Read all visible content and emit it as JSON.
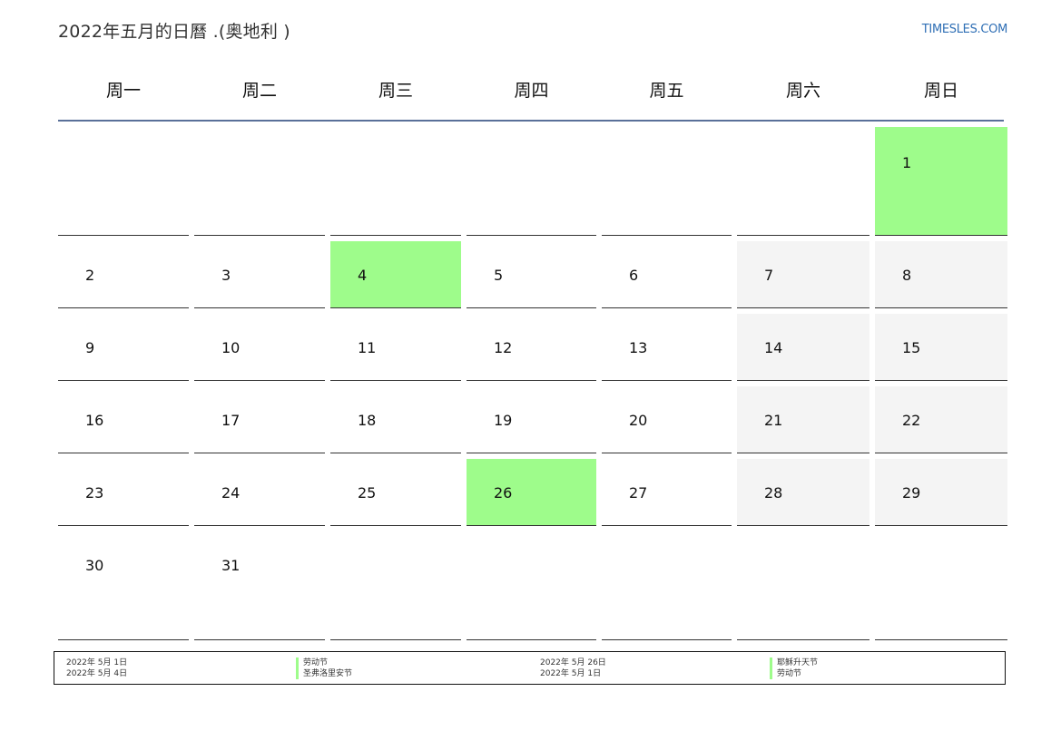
{
  "header": {
    "title": "2022年五月的日曆 .(奥地利 )",
    "site": "TIMESLES.COM"
  },
  "calendar": {
    "weekdays": [
      "周一",
      "周二",
      "周三",
      "周四",
      "周五",
      "周六",
      "周日"
    ],
    "weeks": [
      [
        "",
        "",
        "",
        "",
        "",
        "",
        "1"
      ],
      [
        "2",
        "3",
        "4",
        "5",
        "6",
        "7",
        "8"
      ],
      [
        "9",
        "10",
        "11",
        "12",
        "13",
        "14",
        "15"
      ],
      [
        "16",
        "17",
        "18",
        "19",
        "20",
        "21",
        "22"
      ],
      [
        "23",
        "24",
        "25",
        "26",
        "27",
        "28",
        "29"
      ],
      [
        "30",
        "31",
        "",
        "",
        "",
        "",
        ""
      ]
    ],
    "holiday_color": "#9efc8b",
    "weekend_color": "#f4f4f4"
  },
  "legend": {
    "col1_dates": [
      "2022年 5月 1日",
      "2022年 5月 4日"
    ],
    "col1_names": [
      "劳动节",
      "圣弗洛里安节"
    ],
    "col2_dates": [
      "2022年 5月 26日",
      "2022年 5月 1日"
    ],
    "col2_names": [
      "耶稣升天节",
      "劳动节"
    ]
  }
}
